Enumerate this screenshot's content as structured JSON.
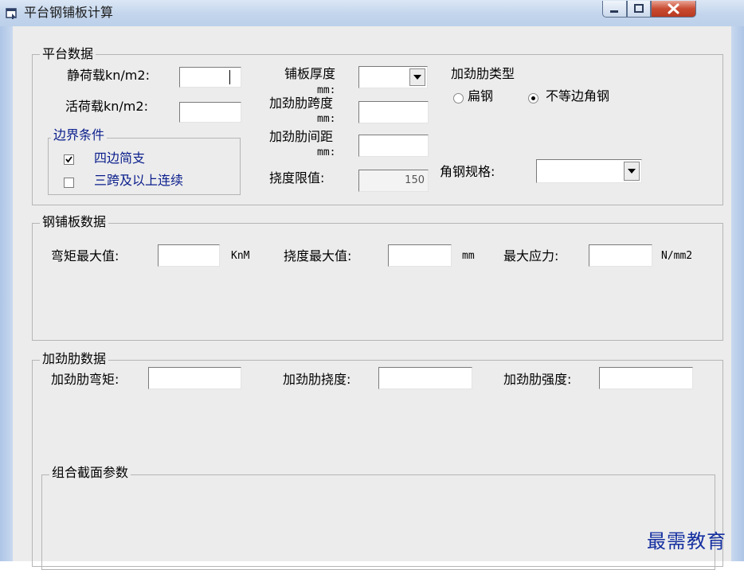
{
  "window": {
    "title": "平台钢铺板计算",
    "icon": "app-icon"
  },
  "platform_group": {
    "label": "平台数据",
    "dead_load_label": "静荷载kn/m2:",
    "dead_load_value": "",
    "live_load_label": "活荷载kn/m2:",
    "live_load_value": "",
    "boundary_group": {
      "label": "边界条件",
      "four_sides": {
        "label": "四边简支",
        "checked": true
      },
      "three_span": {
        "label": "三跨及以上连续",
        "checked": false
      }
    },
    "plate_thickness_label": "铺板厚度",
    "plate_thickness_unit": "mm:",
    "plate_thickness_value": "",
    "stiffener_span_label": "加劲肋跨度",
    "stiffener_span_unit": "mm:",
    "stiffener_span_value": "",
    "stiffener_spacing_label": "加劲肋间距",
    "stiffener_spacing_unit": "mm:",
    "stiffener_spacing_value": "",
    "deflection_limit_label": "挠度限值:",
    "deflection_limit_value": "150",
    "stiffener_type_label": "加劲肋类型",
    "flat_steel_label": "扁钢",
    "unequal_angle_label": "不等边角钢",
    "selected_type": "不等边角钢",
    "angle_spec_label": "角钢规格:",
    "angle_spec_value": ""
  },
  "steel_plate_group": {
    "label": "钢铺板数据",
    "moment_label": "弯矩最大值:",
    "moment_value": "",
    "moment_unit": "KnM",
    "deflection_label": "挠度最大值:",
    "deflection_value": "",
    "deflection_unit": "mm",
    "stress_label": "最大应力:",
    "stress_value": "",
    "stress_unit": "N/mm2"
  },
  "stiffener_group": {
    "label": "加劲肋数据",
    "moment_label": "加劲肋弯矩:",
    "moment_value": "",
    "deflection_label": "加劲肋挠度:",
    "deflection_value": "",
    "strength_label": "加劲肋强度:",
    "strength_value": "",
    "section_group": {
      "label": "组合截面参数"
    }
  },
  "watermark": "最需教育"
}
